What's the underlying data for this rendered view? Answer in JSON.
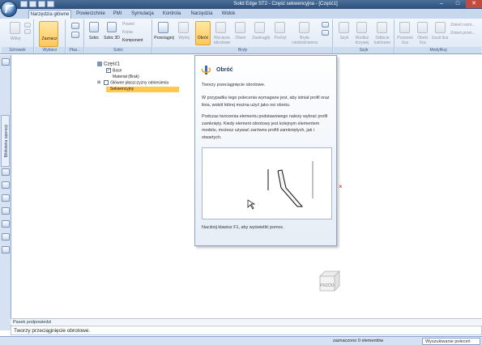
{
  "window": {
    "title": "Solid Edge ST2 - Część sekwencyjna - [Część1]",
    "controls": [
      "–",
      "□",
      "✕"
    ]
  },
  "tabs": [
    {
      "label": "Narzędzia główne",
      "active": true
    },
    {
      "label": "Powierzchnie",
      "active": false
    },
    {
      "label": "PMI",
      "active": false
    },
    {
      "label": "Symulacja",
      "active": false
    },
    {
      "label": "Kontrola",
      "active": false
    },
    {
      "label": "Narzędzia",
      "active": false
    },
    {
      "label": "Widok",
      "active": false
    }
  ],
  "ribbon": {
    "groups": {
      "schowek": "Schowek",
      "wybierz": "Wybierz",
      "plas": "Płas...",
      "szkic": "Szkic",
      "bryly": "Bryły",
      "szyk": "Szyk",
      "modyfikuj": "Modyfikuj"
    },
    "buttons": {
      "wklej": "Wklej",
      "zaznacz": "Zaznacz",
      "szkic": "Szkic",
      "szkic3d": "Szkic 3D",
      "powiel": "Powiel",
      "kopia": "Kopia",
      "komponent": "Komponent",
      "przeciagnij": "Przeciągnij",
      "wytnij": "Wytnij",
      "obroc": "Obróć",
      "wyciecie_obrotowe": "Wycięcie obrotowe",
      "otwor": "Otwór",
      "zaokraglij": "Zaokrąglij",
      "pochyl": "Pochyl",
      "bryla_cienkoscienna": "Bryła cienkościenna",
      "szyk_btn": "Szyk",
      "wzdluz_krzywej": "Wzdłuż krzywej",
      "odbicie_lustrzane": "Odbicie lustrzane",
      "przenies_lica": "Przenieś lica",
      "obroc_lica": "Obróć lica",
      "usun_lica": "Usuń lica",
      "zmien_rozmiar_otworu": "Zmień rozm...",
      "zmien_promien": "Zmień prom..."
    }
  },
  "left_panel": {
    "vertical_tab": "Biblioteka operacji"
  },
  "tree": {
    "root": "Część1",
    "items": [
      {
        "label": "Base",
        "checked": true
      },
      {
        "label": "Materiał (Brak)",
        "checked": false
      },
      {
        "label": "Główne płaszczyzny odniesienia",
        "checked": false
      },
      {
        "label": "Sekwencyjny",
        "checked": false
      }
    ]
  },
  "tooltip": {
    "title": "Obróć",
    "lines": [
      "Tworzy przeciągnięcie obrotowe.",
      "W przypadku tego polecenia wymagane jest, aby istniał profil oraz linia, wokół której można użyć jako osi obrotu.",
      "Podczas tworzenia elementu podstawowego należy wybrać profil zamknięty. Kiedy element obrotowy jest kolejnym elementem modelu, możesz używać zarówno profili zamkniętych, jak i otwartych."
    ],
    "help": "Naciśnij klawisz F1, aby wyświetlić pomoc."
  },
  "view_cube": {
    "label": "PRZÓD"
  },
  "prompt": {
    "header": "Pasek podpowiedzi",
    "text": "Tworzy przeciągnięcie obrotowe."
  },
  "status": {
    "selection": "zaznaczono 0 elementów",
    "search": "Wyszukiwanie poleceń"
  },
  "colors": {
    "accent": "#ffc94d",
    "titlebar": "#2d4e78",
    "ribbon": "#dde8f5",
    "close": "#c24b3f"
  }
}
